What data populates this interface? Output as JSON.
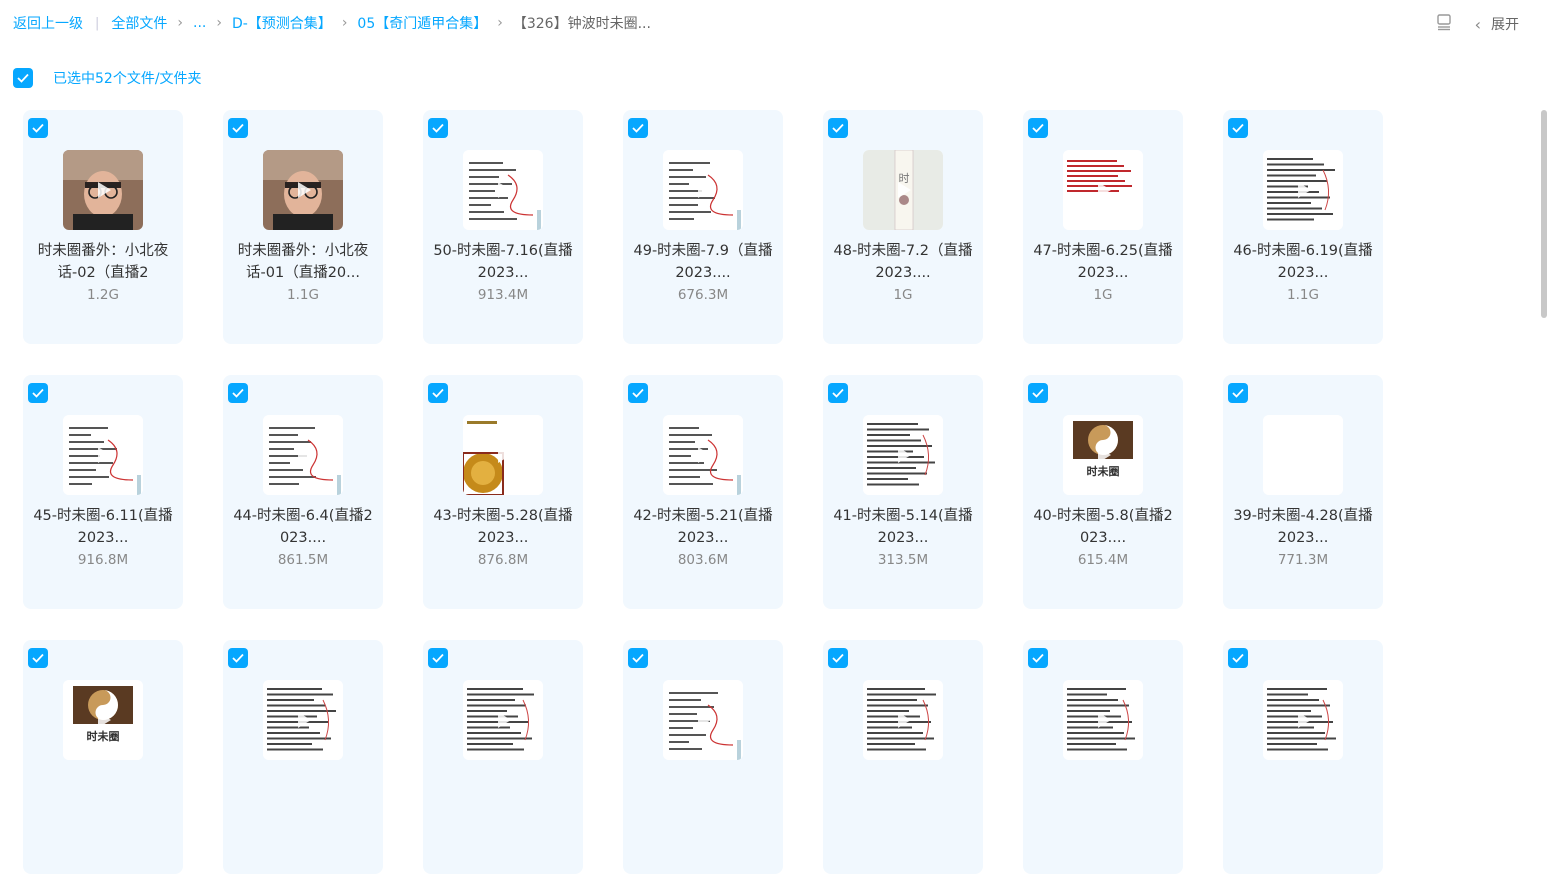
{
  "breadcrumb": {
    "back": "返回上一级",
    "all_files": "全部文件",
    "ellipsis": "...",
    "folder1": "D-【预测合集】",
    "folder2": "05【奇门遁甲合集】",
    "current": "【326】钟波时未圈..."
  },
  "toolbar": {
    "expand_label": "展开"
  },
  "selection": {
    "text": "已选中52个文件/文件夹"
  },
  "colors": {
    "accent": "#06a7ff",
    "card_bg": "#f1f8fe"
  },
  "files": [
    {
      "title": "时未圈番外：小北夜话-02（直播2",
      "size": "1.2G",
      "thumb": "face"
    },
    {
      "title": "时未圈番外：小北夜话-01（直播20...",
      "size": "1.1G",
      "thumb": "face"
    },
    {
      "title": "50-时未圈-7.16(直播2023...",
      "size": "913.4M",
      "thumb": "doc"
    },
    {
      "title": "49-时未圈-7.9（直播2023....",
      "size": "676.3M",
      "thumb": "doc"
    },
    {
      "title": "48-时未圈-7.2（直播2023....",
      "size": "1G",
      "thumb": "scroll"
    },
    {
      "title": "47-时未圈-6.25(直播2023...",
      "size": "1G",
      "thumb": "red"
    },
    {
      "title": "46-时未圈-6.19(直播2023...",
      "size": "1.1G",
      "thumb": "dense"
    },
    {
      "title": "45-时未圈-6.11(直播2023...",
      "size": "916.8M",
      "thumb": "doc"
    },
    {
      "title": "44-时未圈-6.4(直播2023....",
      "size": "861.5M",
      "thumb": "doc"
    },
    {
      "title": "43-时未圈-5.28(直播2023...",
      "size": "876.8M",
      "thumb": "coin"
    },
    {
      "title": "42-时未圈-5.21(直播2023...",
      "size": "803.6M",
      "thumb": "doc"
    },
    {
      "title": "41-时未圈-5.14(直播2023...",
      "size": "313.5M",
      "thumb": "dense"
    },
    {
      "title": "40-时未圈-5.8(直播2023....",
      "size": "615.4M",
      "thumb": "logo"
    },
    {
      "title": "39-时未圈-4.28(直播2023...",
      "size": "771.3M",
      "thumb": "blank"
    },
    {
      "title": "",
      "size": "",
      "thumb": "logo"
    },
    {
      "title": "",
      "size": "",
      "thumb": "dense"
    },
    {
      "title": "",
      "size": "",
      "thumb": "dense"
    },
    {
      "title": "",
      "size": "",
      "thumb": "doc"
    },
    {
      "title": "",
      "size": "",
      "thumb": "dense"
    },
    {
      "title": "",
      "size": "",
      "thumb": "dense"
    },
    {
      "title": "",
      "size": "",
      "thumb": "dense"
    }
  ],
  "thumb_texts": {
    "scroll": "时",
    "logo": "时未圈"
  }
}
